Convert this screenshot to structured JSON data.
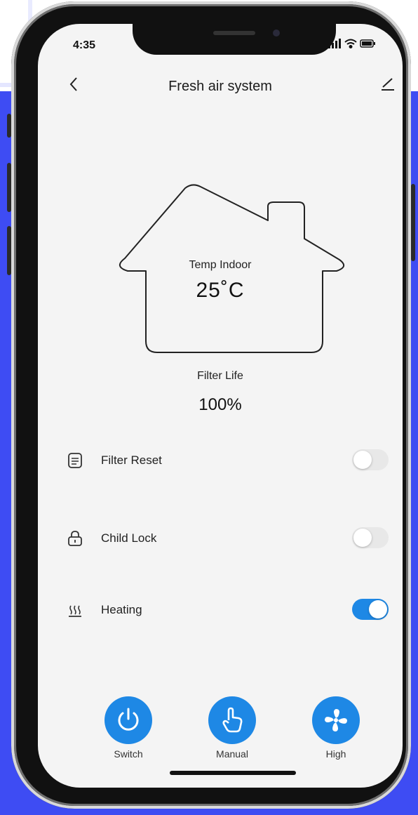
{
  "status": {
    "time": "4:35"
  },
  "nav": {
    "title": "Fresh air system"
  },
  "house": {
    "temp_label": "Temp Indoor",
    "temp_value": "25˚C"
  },
  "filter": {
    "label": "Filter Life",
    "value": "100%"
  },
  "settings": [
    {
      "label": "Filter Reset",
      "icon": "document-list-icon",
      "enabled": false
    },
    {
      "label": "Child Lock",
      "icon": "lock-icon",
      "enabled": false
    },
    {
      "label": "Heating",
      "icon": "heating-icon",
      "enabled": true
    }
  ],
  "controls": [
    {
      "label": "Switch",
      "icon": "power-icon"
    },
    {
      "label": "Manual",
      "icon": "hand-pointer-icon"
    },
    {
      "label": "High",
      "icon": "fan-icon"
    }
  ],
  "colors": {
    "accent": "#1e88e5",
    "background": "#3e4cf3",
    "screen": "#f4f4f4"
  }
}
